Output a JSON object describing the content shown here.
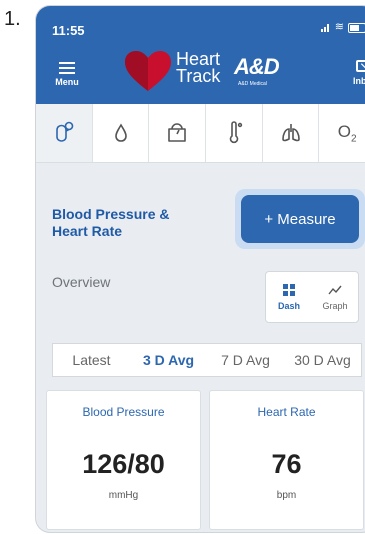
{
  "step_number": "1.",
  "status_bar": {
    "time": "11:55"
  },
  "header": {
    "menu_label": "Menu",
    "logo_line1": "Heart",
    "logo_line2": "Track",
    "partner_logo": "A&D",
    "partner_sub": "A&D Medical",
    "inbox_label": "Inbox"
  },
  "measurement_icons": [
    {
      "name": "blood-pressure-icon",
      "active": true
    },
    {
      "name": "water-drop-icon",
      "active": false
    },
    {
      "name": "scale-icon",
      "active": false
    },
    {
      "name": "thermometer-icon",
      "active": false
    },
    {
      "name": "lungs-icon",
      "active": false
    },
    {
      "name": "o2-icon",
      "label": "O",
      "subscript": "2",
      "active": false
    }
  ],
  "section": {
    "title": "Blood Pressure & Heart Rate",
    "measure_button": "+ Measure",
    "overview_label": "Overview"
  },
  "view_toggle": {
    "dash_label": "Dash",
    "graph_label": "Graph",
    "active": "Dash"
  },
  "period_tabs": [
    {
      "label": "Latest"
    },
    {
      "label": "3 D Avg"
    },
    {
      "label": "7 D Avg"
    },
    {
      "label": "30 D Avg"
    }
  ],
  "active_tab": "3 D Avg",
  "cards": [
    {
      "title": "Blood Pressure",
      "value": "126/80",
      "unit": "mmHg"
    },
    {
      "title": "Heart Rate",
      "value": "76",
      "unit": "bpm"
    }
  ],
  "colors": {
    "primary": "#2d67b0",
    "highlight": "#c9dcf2",
    "heart": "#c8102e"
  }
}
